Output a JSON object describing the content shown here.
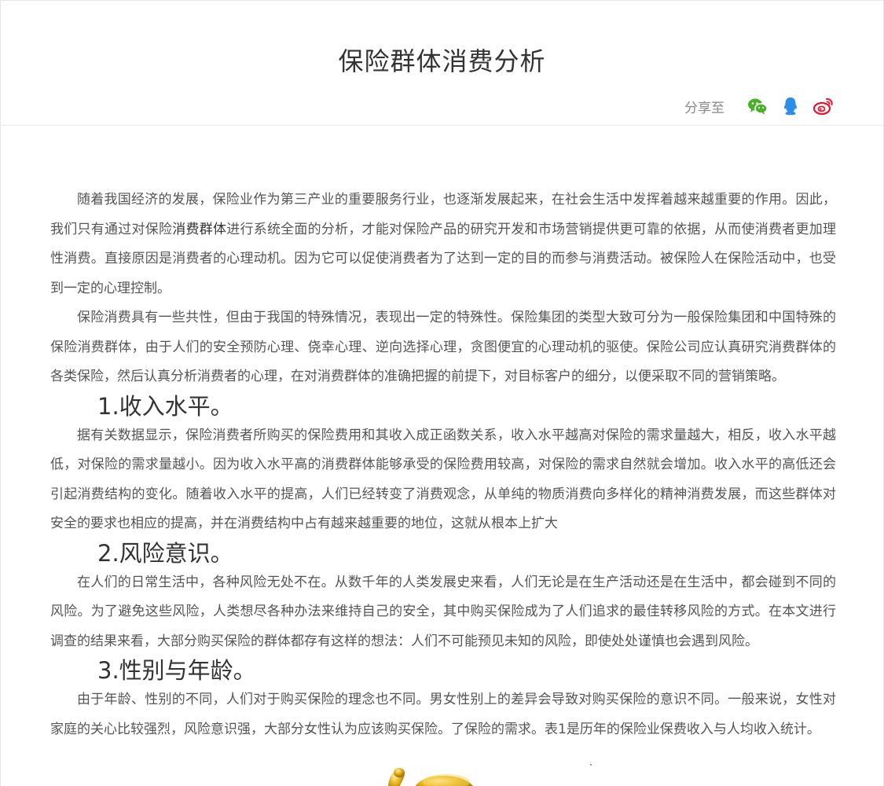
{
  "article": {
    "title": "保险群体消费分析"
  },
  "share": {
    "label": "分享至",
    "icons": {
      "wechat": {
        "name": "wechat-icon",
        "color": "#4caf2a"
      },
      "qq": {
        "name": "qq-icon",
        "color": "#2e8de8"
      },
      "weibo": {
        "name": "weibo-icon",
        "color": "#e6162d"
      }
    }
  },
  "body": {
    "p1_pre": "随着我国经济的发展，保险业作为第三产业的重要服务行业，也逐渐发展起来，在社会生活中发挥着越来越重要的作用。因此，我们只有通过对保险",
    "p1_keyword": "消费群体",
    "p1_post": "进行系统全面的分析，才能对保险产品的研究开发和市场营销提供更可靠的依据，从而使消费者更加理性消费。直接原因是消费者的心理动机。因为它可以促使消费者为了达到一定的目的而参与消费活动。被保险人在保险活动中，也受到一定的心理控制。",
    "p2": "保险消费具有一些共性，但由于我国的特殊情况，表现出一定的特殊性。保险集团的类型大致可分为一般保险集团和中国特殊的保险消费群体，由于人们的安全预防心理、侥幸心理、逆向选择心理，贪图便宜的心理动机的驱使。保险公司应认真研究消费群体的各类保险，然后认真分析消费者的心理，在对消费群体的准确把握的前提下，对目标客户的细分，以便采取不同的营销策略。",
    "h1": "1.收入水平。",
    "p3": "据有关数据显示，保险消费者所购买的保险费用和其收入成正函数关系，收入水平越高对保险的需求量越大，相反，收入水平越低，对保险的需求量越小。因为收入水平高的消费群体能够承受的保险费用较高，对保险的需求自然就会增加。收入水平的高低还会引起消费结构的变化。随着收入水平的提高，人们已经转变了消费观念，从单纯的物质消费向多样化的精神消费发展，而这些群体对安全的要求也相应的提高，并在消费结构中占有越来越重要的地位，这就从根本上扩大",
    "h2": "2.风险意识。",
    "p4": "在人们的日常生活中，各种风险无处不在。从数千年的人类发展史来看，人们无论是在生产活动还是在生活中，都会碰到不同的风险。为了避免这些风险，人类想尽各种办法来维持自己的安全，其中购买保险成为了人们追求的最佳转移风险的方式。在本文进行调查的结果来看，大部分购买保险的群体都存有这样的想法：人们不可能预见未知的风险，即使处处谨慎也会遇到风险。",
    "h3": "3.性别与年龄。",
    "p5": "由于年龄、性别的不同，人们对于购买保险的理念也不同。男女性别上的差异会导致对购买保险的意识不同。一般来说，女性对家庭的关心比较强烈，风险意识强，大部分女性认为应该购买保险。了保险的需求。表1是历年的保险业保费收入与人均收入统计。"
  }
}
